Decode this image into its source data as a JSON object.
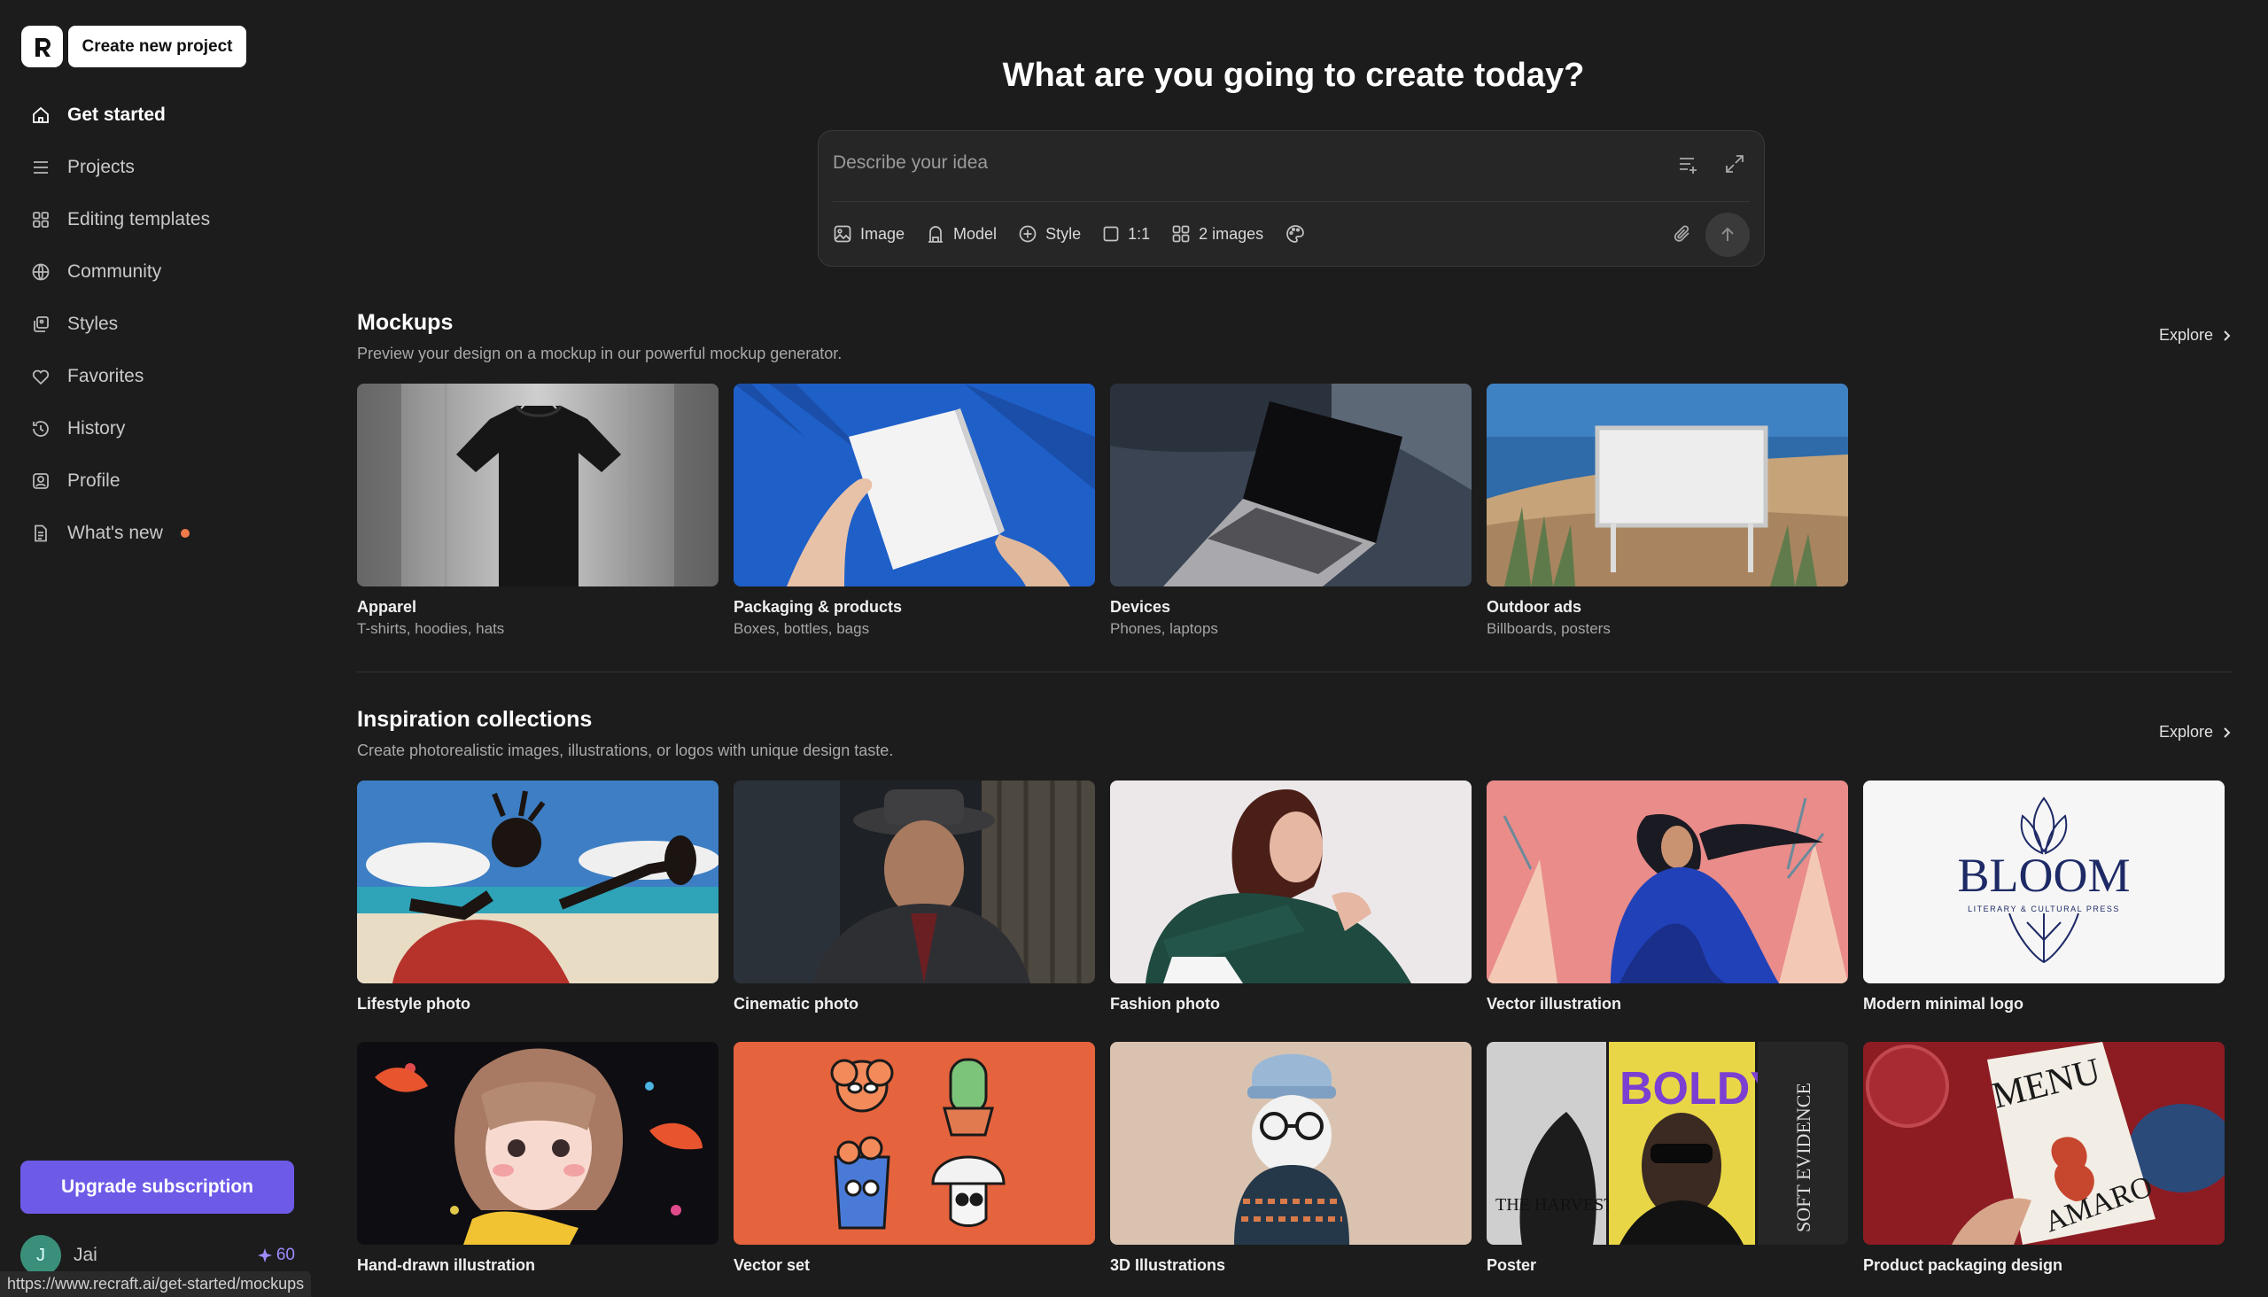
{
  "sidebar": {
    "create_button": "Create new project",
    "nav": [
      {
        "label": "Get started",
        "icon": "home-icon",
        "active": true
      },
      {
        "label": "Projects",
        "icon": "list-icon"
      },
      {
        "label": "Editing templates",
        "icon": "grid-icon"
      },
      {
        "label": "Community",
        "icon": "globe-icon"
      },
      {
        "label": "Styles",
        "icon": "styles-icon"
      },
      {
        "label": "Favorites",
        "icon": "heart-icon"
      },
      {
        "label": "History",
        "icon": "history-icon"
      },
      {
        "label": "Profile",
        "icon": "profile-icon"
      },
      {
        "label": "What's new",
        "icon": "document-icon",
        "badge_color": "#f07a4a"
      }
    ],
    "upgrade_button": "Upgrade subscription",
    "user": {
      "initial": "J",
      "name": "Jai",
      "credits": "60"
    }
  },
  "status_url": "https://www.recraft.ai/get-started/mockups",
  "main": {
    "headline": "What are you going to create today?",
    "prompt": {
      "placeholder": "Describe your idea",
      "tools": {
        "image": "Image",
        "model": "Model",
        "style": "Style",
        "ratio": "1:1",
        "count": "2 images"
      }
    },
    "mockups": {
      "title": "Mockups",
      "subtitle": "Preview your design on a mockup in our powerful mockup generator.",
      "explore": "Explore",
      "cards": [
        {
          "title": "Apparel",
          "subtitle": "T-shirts, hoodies, hats"
        },
        {
          "title": "Packaging & products",
          "subtitle": "Boxes, bottles, bags"
        },
        {
          "title": "Devices",
          "subtitle": "Phones, laptops"
        },
        {
          "title": "Outdoor ads",
          "subtitle": "Billboards, posters"
        }
      ]
    },
    "inspiration": {
      "title": "Inspiration collections",
      "subtitle": "Create photorealistic images, illustrations, or logos with unique design taste.",
      "explore": "Explore",
      "row1": [
        {
          "title": "Lifestyle photo"
        },
        {
          "title": "Cinematic photo"
        },
        {
          "title": "Fashion photo"
        },
        {
          "title": "Vector illustration"
        },
        {
          "title": "Modern minimal logo",
          "logo_text": "BLOOM",
          "logo_tagline": "LITERARY & CULTURAL PRESS"
        }
      ],
      "row2": [
        {
          "title": "Hand-drawn illustration"
        },
        {
          "title": "Vector set"
        },
        {
          "title": "3D Illustrations"
        },
        {
          "title": "Poster",
          "poster_texts": [
            "THE HARVEST",
            "BOLDY",
            "SOFT EVIDENCE"
          ]
        },
        {
          "title": "Product packaging design",
          "packaging_texts": [
            "MENU",
            "AMARO"
          ]
        }
      ]
    }
  },
  "colors": {
    "background": "#1c1c1c",
    "accent": "#6d5be8",
    "notification": "#f07a4a"
  }
}
